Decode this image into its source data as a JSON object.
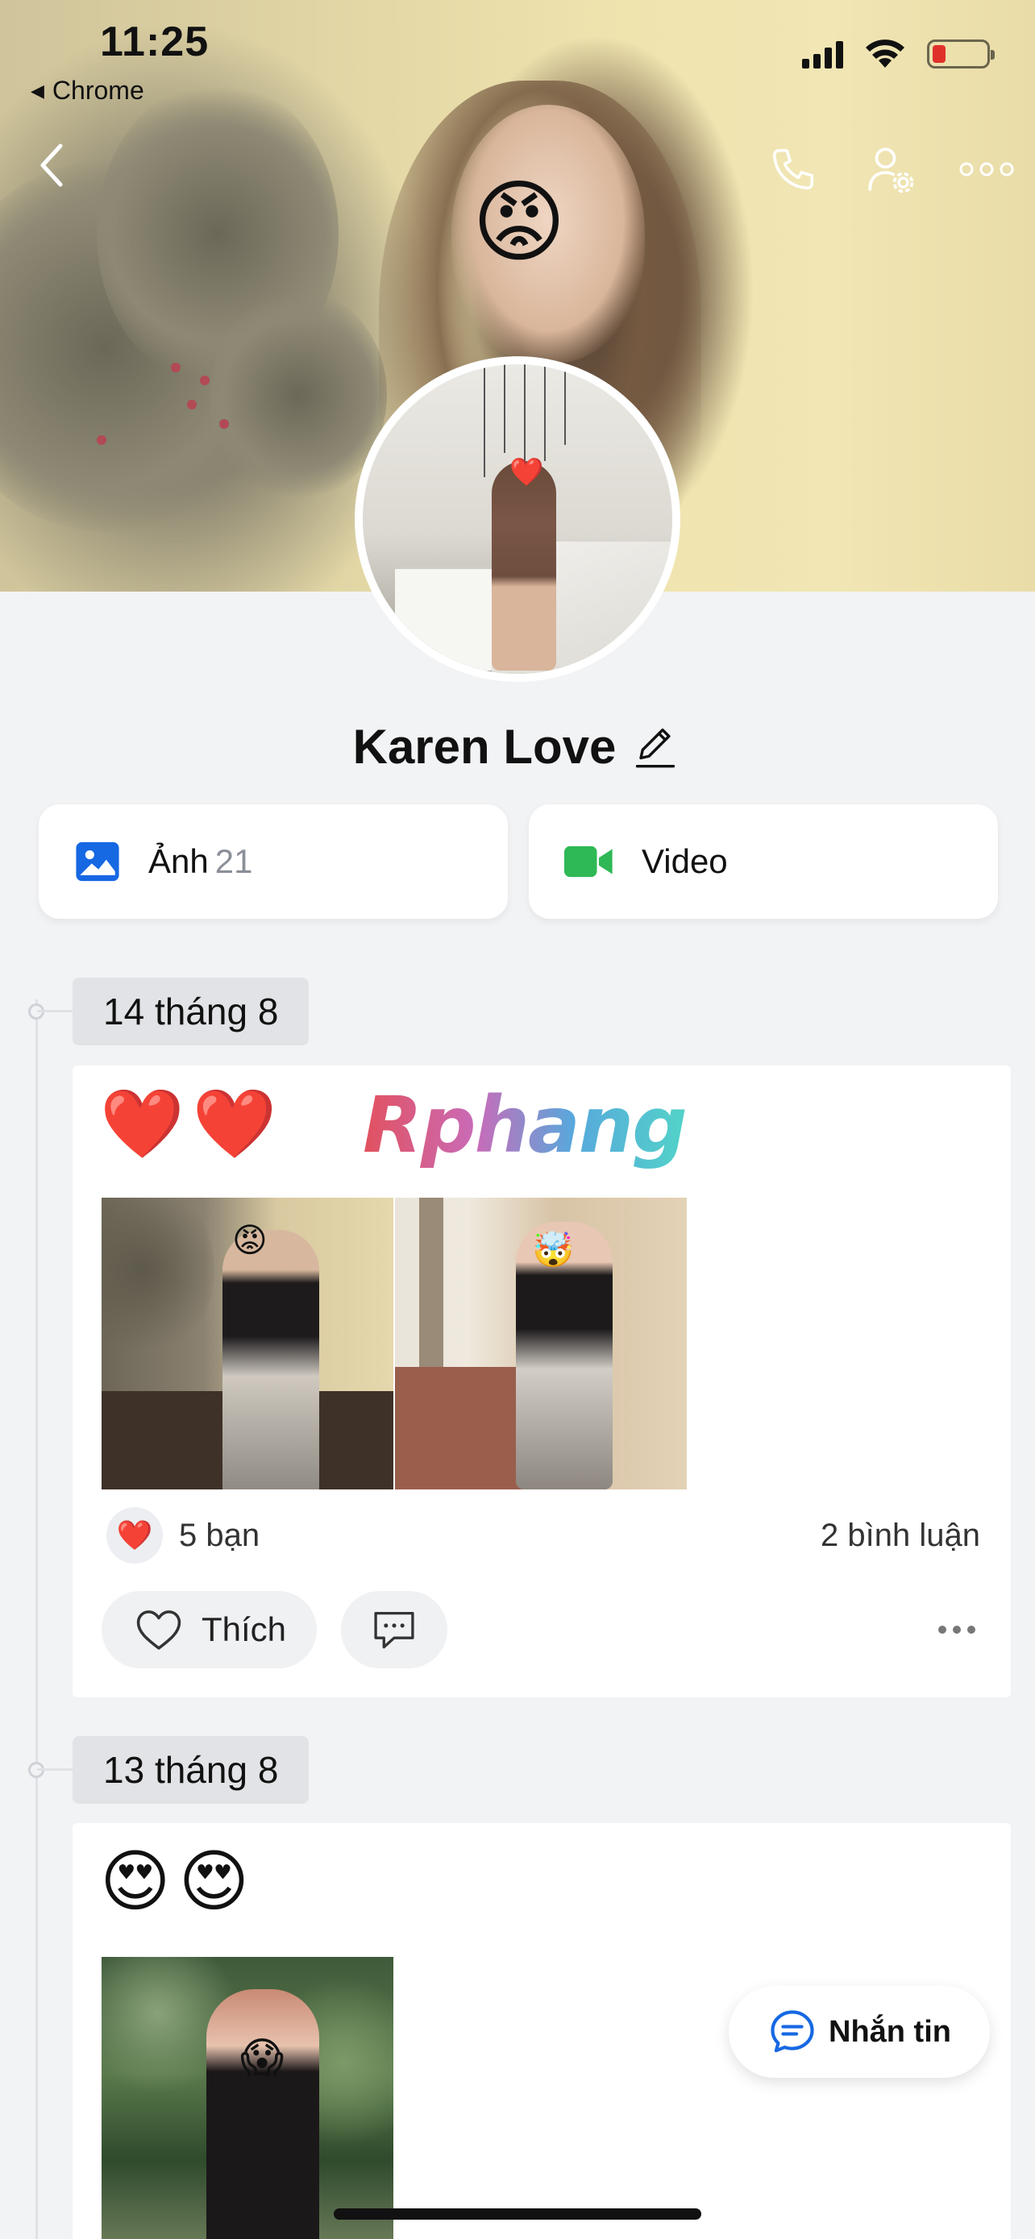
{
  "status_bar": {
    "time": "11:25",
    "back_app": "Chrome",
    "battery_color": "#e0302a"
  },
  "nav": {
    "back_icon": "chevron-left-icon",
    "call_icon": "phone-icon",
    "settings_icon": "user-settings-icon",
    "more_icon": "more-horizontal-icon"
  },
  "cover": {
    "emoji": "😡"
  },
  "profile": {
    "name": "Karen Love",
    "edit_icon": "pencil-icon"
  },
  "media": {
    "photos_label": "Ảnh",
    "photos_count": "21",
    "video_label": "Video",
    "photos_color": "#1668e3",
    "video_color": "#2fb856"
  },
  "posts": [
    {
      "date": "14 tháng 8",
      "text": "❤️❤️",
      "watermark": "Rphang",
      "photo_emojis": [
        "😡",
        "🤯"
      ],
      "reactions": "5 bạn",
      "reaction_icon": "❤️",
      "comments": "2 bình luận",
      "like_label": "Thích"
    },
    {
      "date": "13 tháng 8",
      "text": "😍😍",
      "photo_emojis": [
        "😱"
      ]
    }
  ],
  "fab": {
    "label": "Nhắn tin",
    "accent": "#1668e3"
  }
}
